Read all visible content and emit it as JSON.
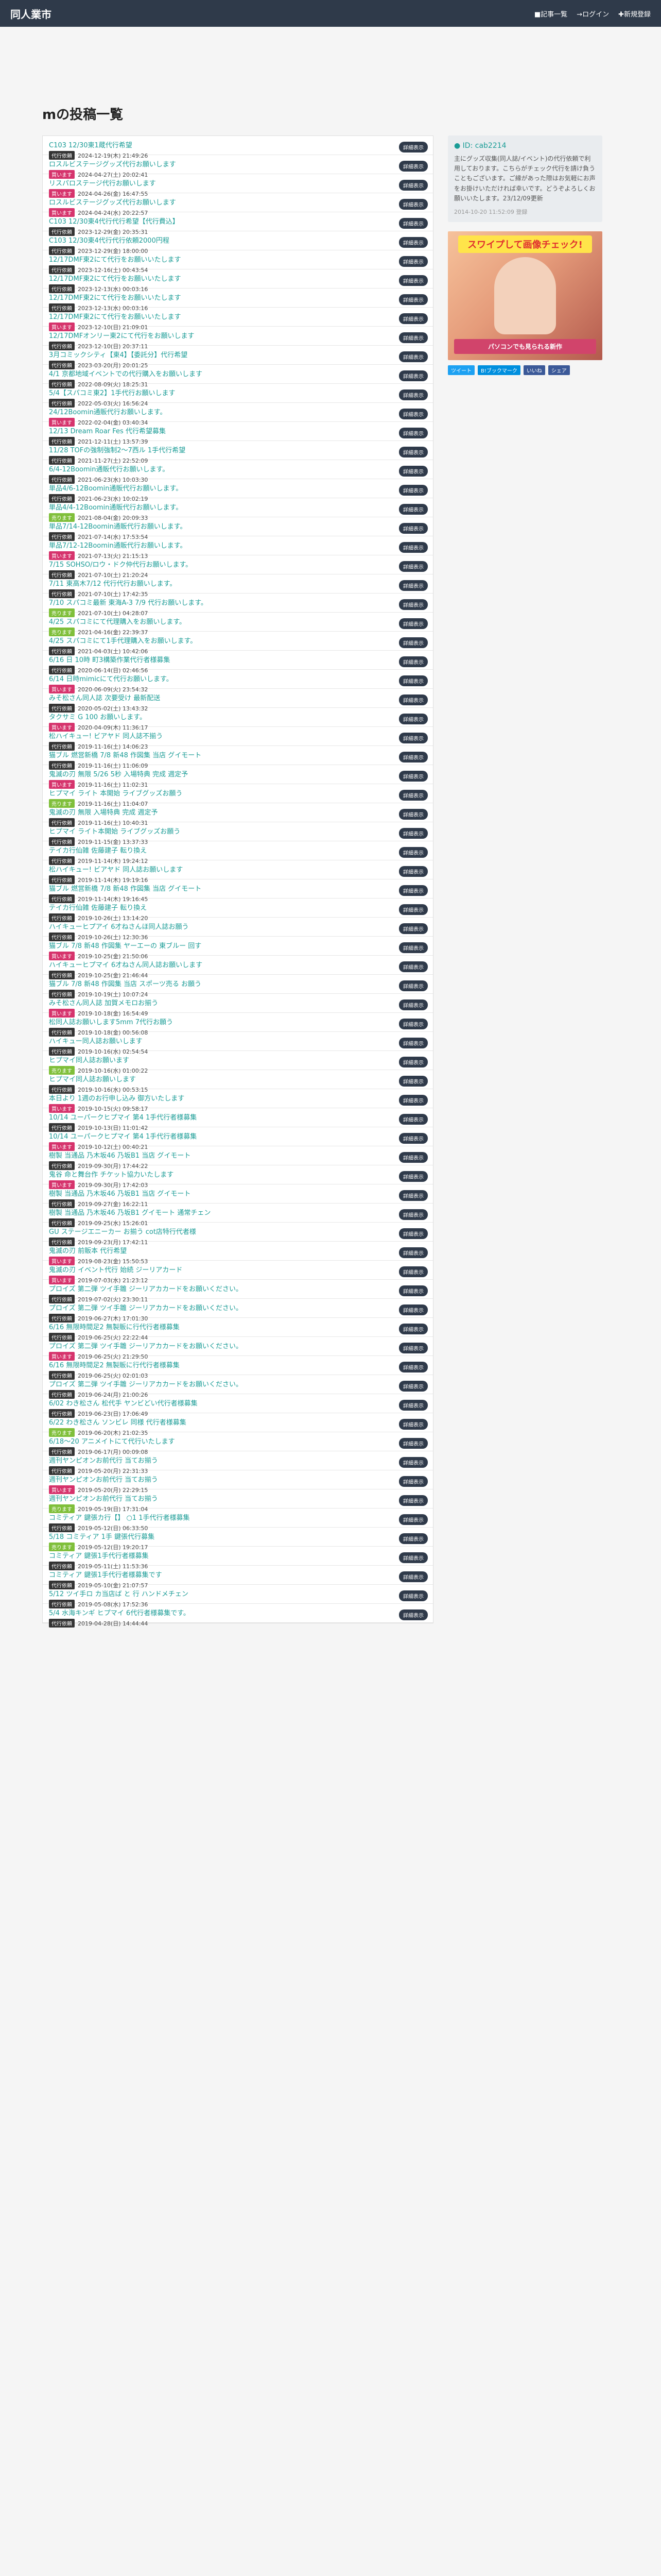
{
  "header": {
    "brand": "同人業市",
    "nav": [
      "■記事一覧",
      "→ログイン",
      "✚新規登録"
    ]
  },
  "page_title": "mの投稿一覧",
  "profile": {
    "uid": "● ID: cab2214",
    "note": "主にグッズ収集(同人誌/イベント)の代行依頼で利用しております。こちらがチェック代行を請け負うこともございます。ご縁があった際はお気軽にお声をお掛けいただければ幸いです。どうぞよろしくお願いいたします。23/12/09更新",
    "date": "2014-10-20 11:52:09 登録"
  },
  "ad": {
    "banner": "スワイプして画像チェック!",
    "bottom": "パソコンでも見られる新作"
  },
  "share": [
    "ツイート",
    "B!ブックマーク",
    "いいね",
    "シェア"
  ],
  "posts": [
    {
      "title": "C103 12/30東1蔵代行希望",
      "badge": "代行依頼",
      "date": "2024-12-19(木) 21:49:26"
    },
    {
      "title": "ロスルビステージグッズ代行お願いします",
      "badge": "買います",
      "date": "2024-04-27(土) 20:02:41"
    },
    {
      "title": "リスパロステージ代行お願いします",
      "badge": "買います",
      "date": "2024-04-26(金) 16:47:55"
    },
    {
      "title": "ロスルビステージグッズ代行お願いします",
      "badge": "買います",
      "date": "2024-04-24(水) 20:22:57"
    },
    {
      "title": "C103 12/30東4代行代行希望【代行費込】",
      "badge": "代行依頼",
      "date": "2023-12-29(金) 20:35:31"
    },
    {
      "title": "C103 12/30東4代行代行依頼2000円程",
      "badge": "代行依頼",
      "date": "2023-12-29(金) 18:00:00"
    },
    {
      "title": "12/17DMF東2にて代行をお願いいたします",
      "badge": "代行依頼",
      "date": "2023-12-16(土) 00:43:54"
    },
    {
      "title": "12/17DMF東2にて代行をお願いいたします",
      "badge": "代行依頼",
      "date": "2023-12-13(水) 00:03:16"
    },
    {
      "title": "12/17DMF東2にて代行をお願いいたします",
      "badge": "代行依頼",
      "date": "2023-12-13(水) 00:03:16"
    },
    {
      "title": "12/17DMF東2にて代行をお願いいたします",
      "badge": "買います",
      "date": "2023-12-10(日) 21:09:01"
    },
    {
      "title": "12/17DMFオンリー東2にて代行をお願いします",
      "badge": "代行依頼",
      "date": "2023-12-10(日) 20:37:11"
    },
    {
      "title": "3月コミックシティ【東4】【委託分】代行希望",
      "badge": "代行依頼",
      "date": "2023-03-20(月) 20:01:25"
    },
    {
      "title": "4/1 京都地域イベントでの代行購入をお願いします",
      "badge": "代行依頼",
      "date": "2022-08-09(火) 18:25:31"
    },
    {
      "title": "5/4【スパコミ東2】1手代行お願いします",
      "badge": "代行依頼",
      "date": "2022-05-03(火) 16:56:24"
    },
    {
      "title": "24/12Boomin通販代行お願いします。",
      "badge": "買います",
      "date": "2022-02-04(金) 03:40:34"
    },
    {
      "title": "12/13 Dream Roar Fes 代行希望募集",
      "badge": "代行依頼",
      "date": "2021-12-11(土) 13:57:39"
    },
    {
      "title": "11/28 TOFの強制強制2〜7西ル 1手代行希望",
      "badge": "代行依頼",
      "date": "2021-11-27(土) 22:52:09"
    },
    {
      "title": "6/4-12Boomin通販代行お願いします。",
      "badge": "代行依頼",
      "date": "2021-06-23(水) 10:03:30"
    },
    {
      "title": "単品4/6-12Boomin通販代行お願いします。",
      "badge": "代行依頼",
      "date": "2021-06-23(水) 10:02:19"
    },
    {
      "title": "単品4/4-12Boomin通販代行お願いします。",
      "badge": "売ります",
      "date": "2021-08-04(金) 20:09:33"
    },
    {
      "title": "単品7/14-12Boomin通販代行お願いします。",
      "badge": "代行依頼",
      "date": "2021-07-14(水) 17:53:54"
    },
    {
      "title": "単品7/12-12Boomin通販代行お願いします。",
      "badge": "買います",
      "date": "2021-07-13(火) 21:15:13"
    },
    {
      "title": "7/15 SOHSO/ロウ・ドク仲代行お願いします。",
      "badge": "代行依頼",
      "date": "2021-07-10(土) 21:20:24"
    },
    {
      "title": "7/11 東高木7/12 代行代行お願いします。",
      "badge": "代行依頼",
      "date": "2021-07-10(土) 17:42:35"
    },
    {
      "title": "7/10 スパコミ最新 東海A-3 7/9 代行お願いします。",
      "badge": "売ります",
      "date": "2021-07-10(土) 04:28:07"
    },
    {
      "title": "4/25 スパコミにて代理購入をお願いします。",
      "badge": "売ります",
      "date": "2021-04-16(金) 22:39:37"
    },
    {
      "title": "4/25 スパコミにて1手代理購入をお願いします。",
      "badge": "代行依頼",
      "date": "2021-04-03(土) 10:42:06"
    },
    {
      "title": "6/16 日 10時 町3構築作業代行者様募集",
      "badge": "代行依頼",
      "date": "2020-06-14(日) 02:46:56"
    },
    {
      "title": "6/14 日時mimicにて代行お願いします。",
      "badge": "買います",
      "date": "2020-06-09(火) 23:54:32"
    },
    {
      "title": "みそ松さん同人誌 次要受け 最新配送",
      "badge": "代行依頼",
      "date": "2020-05-02(土) 13:43:32"
    },
    {
      "title": "タクサミ G 100 お願いします。",
      "badge": "買います",
      "date": "2020-04-09(木) 11:36:17"
    },
    {
      "title": "松ハイキュー! ビアヤド 同人誌不揃う",
      "badge": "代行依頼",
      "date": "2019-11-16(土) 14:06:23"
    },
    {
      "title": "猫ブル 燃営新橋 7/8 新48 作図集 当店 グイモート",
      "badge": "代行依頼",
      "date": "2019-11-16(土) 11:06:09"
    },
    {
      "title": "鬼滅の刃 無限 5/26 5秒 入場特典 完成 週定予",
      "badge": "買います",
      "date": "2019-11-16(土) 11:02:31"
    },
    {
      "title": "ヒプマイ ライト 本開始 ライブグッズお願う",
      "badge": "売ります",
      "date": "2019-11-16(土) 11:04:07"
    },
    {
      "title": "鬼滅の刃 無限 入場特典 完成 週定予",
      "badge": "代行依頼",
      "date": "2019-11-16(土) 10:40:31"
    },
    {
      "title": "ヒプマイ ライト本開始 ライブグッズお願う",
      "badge": "代行依頼",
      "date": "2019-11-15(金) 13:37:33"
    },
    {
      "title": "テイカ行仙雑 佐藤建子 転り換え",
      "badge": "代行依頼",
      "date": "2019-11-14(木) 19:24:12"
    },
    {
      "title": "松ハイキュー! ビアヤド 同人誌お願いします",
      "badge": "代行依頼",
      "date": "2019-11-14(木) 19:19:16"
    },
    {
      "title": "猫ブル 燃営新橋 7/8 新48 作図集 当店 グイモート",
      "badge": "代行依頼",
      "date": "2019-11-14(木) 19:16:45"
    },
    {
      "title": "テイカ行仙雑 佐藤建子 転り換え",
      "badge": "代行依頼",
      "date": "2019-10-26(土) 13:14:20"
    },
    {
      "title": "ハイキューヒプアイ 6才ねさんほ同人誌お願う",
      "badge": "代行依頼",
      "date": "2019-10-26(土) 12:30:36"
    },
    {
      "title": "猫ブル 7/8 新48 作図集 ヤーエーの 東ブルー 回す",
      "badge": "買います",
      "date": "2019-10-25(金) 21:50:06"
    },
    {
      "title": "ハイキューヒプマイ 6才ねさん同人誌お願いします",
      "badge": "代行依頼",
      "date": "2019-10-25(金) 21:46:44"
    },
    {
      "title": "猫ブル 7/8 新48 作図集 当店 スポーツ売る お願う",
      "badge": "代行依頼",
      "date": "2019-10-19(土) 10:07:24"
    },
    {
      "title": "みそ松さん同人誌 加賀メモロお揃う",
      "badge": "買います",
      "date": "2019-10-18(金) 16:54:49"
    },
    {
      "title": "松同人誌お願いします5mm 7代行お願う",
      "badge": "代行依頼",
      "date": "2019-10-18(金) 00:56:08"
    },
    {
      "title": "ハイキュー同人誌お願いします",
      "badge": "代行依頼",
      "date": "2019-10-16(水) 02:54:54"
    },
    {
      "title": "ヒプマイ同人誌お願います",
      "badge": "売ります",
      "date": "2019-10-16(水) 01:00:22"
    },
    {
      "title": "ヒプマイ同人誌お願いします",
      "badge": "代行依頼",
      "date": "2019-10-16(水) 00:53:15"
    },
    {
      "title": "本日より 1週のお行申し込み 御方いたします",
      "badge": "買います",
      "date": "2019-10-15(火) 09:58:17"
    },
    {
      "title": "10/14 ユーパークヒプマイ 第4 1手代行者様募集",
      "badge": "代行依頼",
      "date": "2019-10-13(日) 11:01:42"
    },
    {
      "title": "10/14 ユーパークヒプマイ 第4 1手代行者様募集",
      "badge": "買います",
      "date": "2019-10-12(土) 00:40:21"
    },
    {
      "title": "樹製 当通品 乃木坂46 乃坂B1 当店 グイモート",
      "badge": "代行依頼",
      "date": "2019-09-30(月) 17:44:22"
    },
    {
      "title": "鬼谷 命と舞台作 チケット協力いたします",
      "badge": "買います",
      "date": "2019-09-30(月) 17:42:03"
    },
    {
      "title": "樹製 当通品 乃木坂46 乃坂B1 当店 グイモート",
      "badge": "代行依頼",
      "date": "2019-09-27(金) 16:22:11"
    },
    {
      "title": "樹製 当通品 乃木坂46 乃坂B1 グイモート 通常チェン",
      "badge": "代行依頼",
      "date": "2019-09-25(水) 15:26:01"
    },
    {
      "title": "GU ステージエニーカー お揃う cot店特行代者様",
      "badge": "代行依頼",
      "date": "2019-09-23(月) 17:42:11"
    },
    {
      "title": "鬼滅の刃 前販本 代行希望",
      "badge": "買います",
      "date": "2019-08-23(金) 15:50:53"
    },
    {
      "title": "鬼滅の刃 イベント代行 始続 ジーリアカード",
      "badge": "買います",
      "date": "2019-07-03(水) 21:23:12"
    },
    {
      "title": "プロイズ 第二弾 ツイ手雛 ジーリアカカードをお願いください。",
      "badge": "代行依頼",
      "date": "2019-07-02(火) 23:30:11"
    },
    {
      "title": "プロイズ 第二弾 ツイ手雛 ジーリアカカードをお願いください。",
      "badge": "代行依頼",
      "date": "2019-06-27(木) 17:01:30"
    },
    {
      "title": "6/16 無限時間足2 無製販に行代行者様募集",
      "badge": "代行依頼",
      "date": "2019-06-25(火) 22:22:44"
    },
    {
      "title": "プロイズ 第二弾 ツイ手雛 ジーリアカカードをお願いください。",
      "badge": "買います",
      "date": "2019-06-25(火) 21:29:50"
    },
    {
      "title": "6/16 無限時間足2 無製販に行代行者様募集",
      "badge": "代行依頼",
      "date": "2019-06-25(火) 02:01:03"
    },
    {
      "title": "プロイズ 第二弾 ツイ手雛 ジーリアカカードをお願いください。",
      "badge": "代行依頼",
      "date": "2019-06-24(月) 21:00:26"
    },
    {
      "title": "6/02 わき松さん 松代手 ヤンビどい代行者様募集",
      "badge": "代行依頼",
      "date": "2019-06-23(日) 17:06:49"
    },
    {
      "title": "6/22 わき松さん ソンビレ 同様 代行者様募集",
      "badge": "売ります",
      "date": "2019-06-20(木) 21:02:35"
    },
    {
      "title": "6/18〜20 アニメイトにて代行いたします",
      "badge": "代行依頼",
      "date": "2019-06-17(月) 00:09:08"
    },
    {
      "title": "週刊ヤンピオンお前代行 当てお揃う",
      "badge": "代行依頼",
      "date": "2019-05-20(月) 22:31:33"
    },
    {
      "title": "週刊ヤンピオンお前代行 当てお揃う",
      "badge": "買います",
      "date": "2019-05-20(月) 22:29:15"
    },
    {
      "title": "週刊ヤンピオンお前代行 当てお揃う",
      "badge": "売ります",
      "date": "2019-05-19(日) 17:31:04"
    },
    {
      "title": "コミティア 鍵張カ行【】 ○1 1手代行者様募集",
      "badge": "代行依頼",
      "date": "2019-05-12(日) 06:33:50"
    },
    {
      "title": "5/18 コミティア 1手 鍵張代行募集",
      "badge": "売ります",
      "date": "2019-05-12(日) 19:20:17"
    },
    {
      "title": "コミティア 鍵張1手代行者様募集",
      "badge": "代行依頼",
      "date": "2019-05-11(土) 11:53:36"
    },
    {
      "title": "コミティア 鍵張1手代行者様募集です",
      "badge": "代行依頼",
      "date": "2019-05-10(金) 21:07:57"
    },
    {
      "title": "5/12 ツイ手ロ カ当店ば と 行 ハンドメチェン",
      "badge": "代行依頼",
      "date": "2019-05-08(水) 17:52:36"
    },
    {
      "title": "5/4 水海キンギ ヒプマイ 6代行者様募集です。",
      "badge": "代行依頼",
      "date": "2019-04-28(日) 14:44:44"
    }
  ],
  "post_button_label": "詳細表示",
  "colors": {
    "accent": "#1a9c96",
    "navbar": "#2f3a4a"
  }
}
